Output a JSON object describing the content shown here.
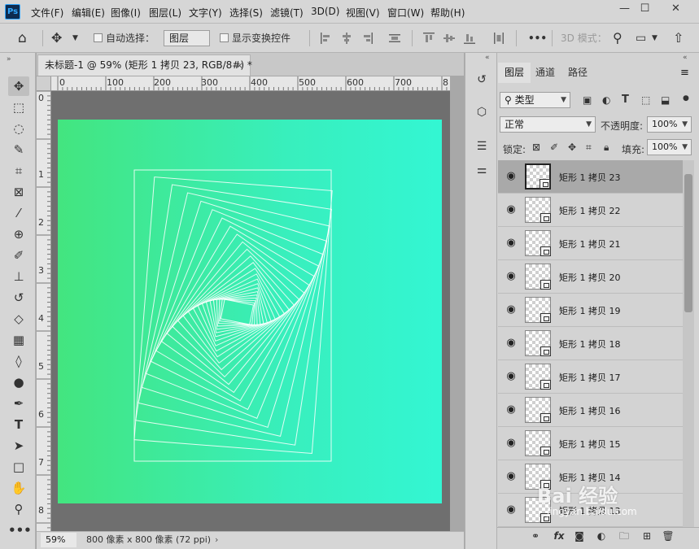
{
  "app": {
    "logo": "Ps"
  },
  "menu": [
    "文件(F)",
    "编辑(E)",
    "图像(I)",
    "图层(L)",
    "文字(Y)",
    "选择(S)",
    "滤镜(T)",
    "3D(D)",
    "视图(V)",
    "窗口(W)",
    "帮助(H)"
  ],
  "window_controls": {
    "minimize": "—",
    "maximize": "☐",
    "close": "✕"
  },
  "options": {
    "auto_select_label": "自动选择：",
    "auto_select_value": "图层",
    "show_transform_label": "显示变换控件",
    "mode_3d_label": "3D 模式：",
    "more": "•••"
  },
  "document": {
    "tab_title": "未标题-1 @ 59% (矩形 1 拷贝 23, RGB/8#) *",
    "tab_close": "×",
    "ruler_h_labels": [
      "0",
      "100",
      "200",
      "300",
      "400",
      "500",
      "600",
      "700",
      "8"
    ],
    "ruler_v_labels": [
      "0",
      "1",
      "2",
      "3",
      "4",
      "5",
      "6",
      "7",
      "8"
    ],
    "zoom": "59%",
    "size_info": "800 像素 x 800 像素 (72 ppi)",
    "status_arrow": "›"
  },
  "panel": {
    "tabs": [
      "图层",
      "通道",
      "路径"
    ],
    "filter_kind": "类型",
    "blend_mode": "正常",
    "opacity_label": "不透明度:",
    "opacity_value": "100%",
    "lock_label": "锁定:",
    "fill_label": "填充:",
    "fill_value": "100%",
    "menu_icon": "≡",
    "collapse": "«"
  },
  "layers": [
    {
      "name": "矩形 1 拷贝 23",
      "selected": true
    },
    {
      "name": "矩形 1 拷贝 22",
      "selected": false
    },
    {
      "name": "矩形 1 拷贝 21",
      "selected": false
    },
    {
      "name": "矩形 1 拷贝 20",
      "selected": false
    },
    {
      "name": "矩形 1 拷贝 19",
      "selected": false
    },
    {
      "name": "矩形 1 拷贝 18",
      "selected": false
    },
    {
      "name": "矩形 1 拷贝 17",
      "selected": false
    },
    {
      "name": "矩形 1 拷贝 16",
      "selected": false
    },
    {
      "name": "矩形 1 拷贝 15",
      "selected": false
    },
    {
      "name": "矩形 1 拷贝 14",
      "selected": false
    },
    {
      "name": "矩形 1 拷贝 13",
      "selected": false
    }
  ],
  "watermark": {
    "brand": "Bai 经验",
    "url": "jingyan.baidu.com"
  },
  "colors": {
    "gradient_start": "#43e57f",
    "gradient_end": "#33f6d3",
    "ui_bg": "#d6d6d6"
  }
}
